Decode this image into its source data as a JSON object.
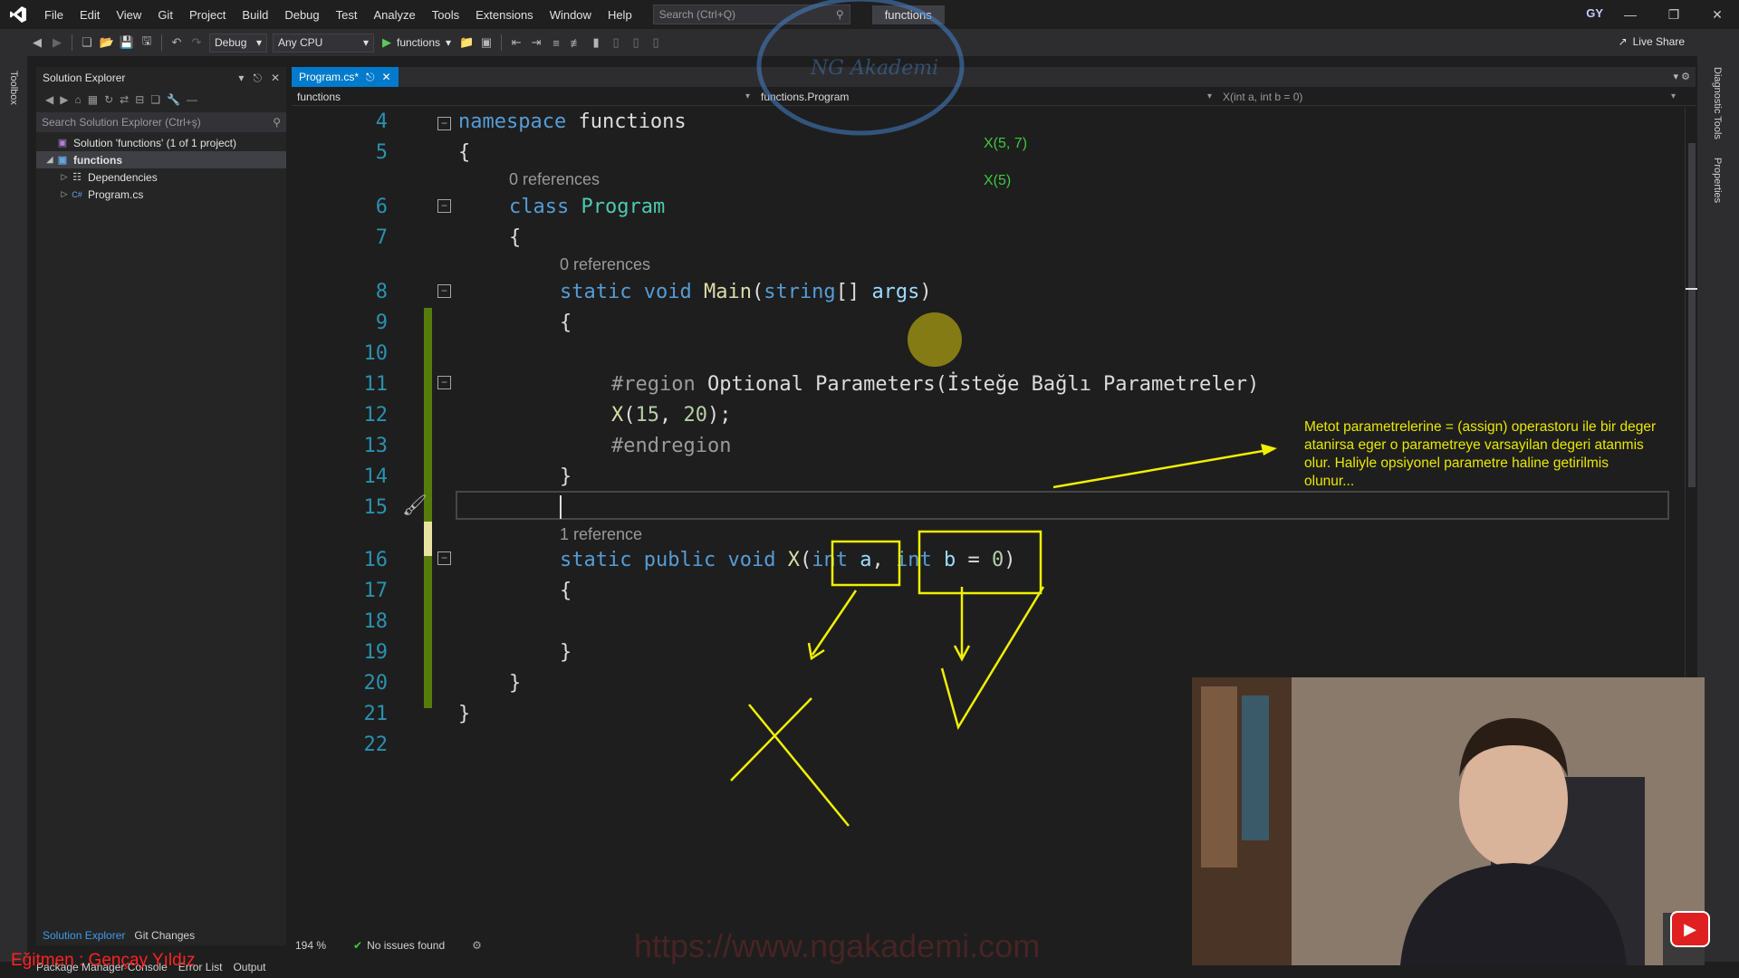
{
  "menu": {
    "items": [
      "File",
      "Edit",
      "View",
      "Git",
      "Project",
      "Build",
      "Debug",
      "Test",
      "Analyze",
      "Tools",
      "Extensions",
      "Window",
      "Help"
    ],
    "search_placeholder": "Search (Ctrl+Q)",
    "solution_title": "functions",
    "account_initials": "GY"
  },
  "toolbar": {
    "config": "Debug",
    "platform": "Any CPU",
    "run_target": "functions",
    "live_share": "Live Share"
  },
  "left_strip": {
    "toolbox": "Toolbox"
  },
  "right_strip": {
    "diagnostic": "Diagnostic Tools",
    "properties": "Properties"
  },
  "solution_explorer": {
    "title": "Solution Explorer",
    "search_placeholder": "Search Solution Explorer (Ctrl+ş)",
    "tree": {
      "solution": "Solution 'functions' (1 of 1 project)",
      "project": "functions",
      "dependencies": "Dependencies",
      "program": "Program.cs"
    },
    "tabs": {
      "solution": "Solution Explorer",
      "git": "Git Changes"
    }
  },
  "editor": {
    "tab_label": "Program.cs*",
    "nav": {
      "project": "functions",
      "class": "functions.Program",
      "member": "X(int a, int b = 0)"
    },
    "codelens": {
      "zero_refs_class": "0 references",
      "zero_refs_main": "0 references",
      "one_ref": "1 reference"
    },
    "lines": {
      "l4": {
        "n": "4",
        "kw": "namespace",
        "rest": " functions"
      },
      "l5": {
        "n": "5",
        "t": "{"
      },
      "l6": {
        "n": "6",
        "kw": "class",
        "ty": "Program"
      },
      "l7": {
        "n": "7",
        "t": "{"
      },
      "l8": {
        "n": "8",
        "kw1": "static",
        "kw2": "void",
        "fn": "Main",
        "p1": "(",
        "kw3": "string",
        "p2": "[] ",
        "pr": "args",
        "p3": ")"
      },
      "l9": {
        "n": "9",
        "t": "{"
      },
      "l10": {
        "n": "10"
      },
      "l11": {
        "n": "11",
        "gray": "#region",
        "rest": " Optional Parameters(İsteğe Bağlı Parametreler)"
      },
      "l12": {
        "n": "12",
        "fn": "X",
        "p1": "(",
        "a": "15",
        "p2": ", ",
        "b": "20",
        "p3": ");"
      },
      "l13": {
        "n": "13",
        "gray": "#endregion"
      },
      "l14": {
        "n": "14",
        "t": "}"
      },
      "l15": {
        "n": "15"
      },
      "l16": {
        "n": "16",
        "kw1": "static",
        "kw2": "public",
        "kw3": "void",
        "fn": "X",
        "p1": "(",
        "kw4": "int",
        "pa": "a",
        "p2": ", ",
        "kw5": "int",
        "pb": "b",
        "p3": " = ",
        "num": "0",
        "p4": ")"
      },
      "l17": {
        "n": "17",
        "t": "{"
      },
      "l18": {
        "n": "18"
      },
      "l19": {
        "n": "19",
        "t": "}"
      },
      "l20": {
        "n": "20",
        "t": "}"
      },
      "l21": {
        "n": "21",
        "t": "}"
      },
      "l22": {
        "n": "22"
      }
    }
  },
  "annotations": {
    "hint1": "X(5, 7)",
    "hint2": "X(5)",
    "note": "Metot parametrelerine = (assign) operastoru ile bir deger atanirsa eger o parametreye varsayilan degeri atanmis olur. Haliyle opsiyonel parametre haline getirilmis olunur..."
  },
  "status": {
    "zoom": "194 %",
    "issues": "No issues found",
    "bottom_tabs": [
      "Package Manager Console",
      "Error List",
      "Output"
    ]
  },
  "overlay": {
    "watermark": "https://www.ngakademi.com",
    "logo_text": "NG Akademi",
    "instructor": "Eğitmen : Gençay Yıldız"
  },
  "colors": {
    "accent": "#007acc",
    "annotation": "#e8e800",
    "keyword": "#569cd6",
    "type": "#4ec9b0",
    "method": "#dcdcaa",
    "parameter": "#9cdcfe",
    "line_number": "#2b91af"
  }
}
